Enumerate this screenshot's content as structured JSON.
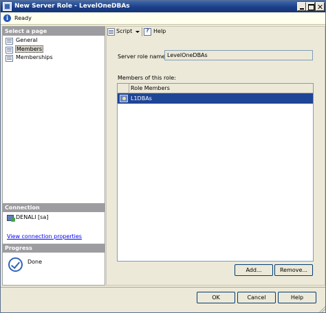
{
  "window": {
    "title": "New Server Role - LevelOneDBAs"
  },
  "status": {
    "text": "Ready"
  },
  "left_pane": {
    "select_page_header": "Select a page",
    "pages": [
      {
        "label": "General",
        "selected": false
      },
      {
        "label": "Members",
        "selected": true
      },
      {
        "label": "Memberships",
        "selected": false
      }
    ],
    "connection_header": "Connection",
    "server_text": "DENALI [sa]",
    "connection_link": "View connection properties",
    "progress_header": "Progress",
    "progress_text": "Done"
  },
  "toolbar": {
    "script_label": "Script",
    "help_label": "Help"
  },
  "form": {
    "server_role_name_label": "Server role name:",
    "server_role_name_value": "LevelOneDBAs",
    "members_label": "Members of this role:",
    "grid_header": "Role Members",
    "rows": [
      "L1DBAs"
    ],
    "add_label": "Add...",
    "remove_label": "Remove..."
  },
  "dialog_buttons": {
    "ok": "OK",
    "cancel": "Cancel",
    "help": "Help"
  }
}
